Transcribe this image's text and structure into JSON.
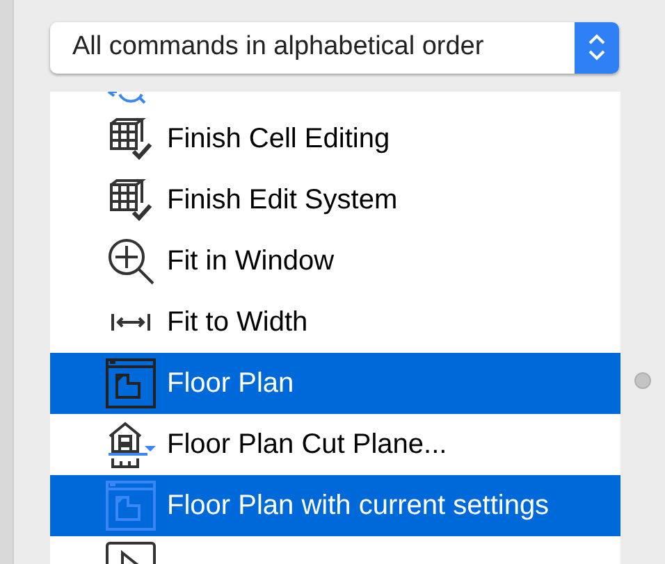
{
  "dropdown": {
    "value": "All commands in alphabetical order"
  },
  "commands": [
    {
      "label": "Finish Cell Editing",
      "selected": false
    },
    {
      "label": "Finish Edit System",
      "selected": false
    },
    {
      "label": "Fit in Window",
      "selected": false
    },
    {
      "label": "Fit to Width",
      "selected": false
    },
    {
      "label": "Floor Plan",
      "selected": true
    },
    {
      "label": "Floor Plan Cut Plane...",
      "selected": false
    },
    {
      "label": "Floor Plan with current settings",
      "selected": true
    },
    {
      "selected": false
    }
  ]
}
